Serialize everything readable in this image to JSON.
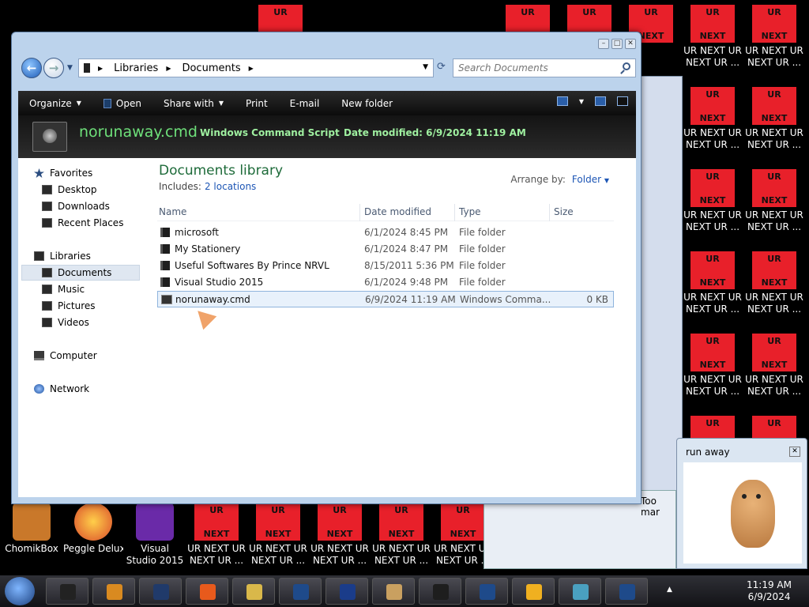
{
  "desktop": {
    "ur_tiles_top": [
      {
        "line1": "UR",
        "line2": ""
      },
      {
        "line1": "UR",
        "line2": ""
      },
      {
        "line1": "UR",
        "line2": ""
      },
      {
        "line1": "UR",
        "line2": "NEXT"
      },
      {
        "line1": "UR",
        "line2": "NEXT"
      },
      {
        "line1": "UR",
        "line2": "NEXT"
      }
    ],
    "ur_tile_label": "UR NEXT UR NEXT UR ...",
    "ur_tile_text1": "UR",
    "ur_tile_text2": "NEXT",
    "bottom_apps": [
      {
        "label": "ChomikBox",
        "color": "#c9782a"
      },
      {
        "label": "Peggle Deluxe",
        "color": "#d94a2a"
      },
      {
        "label": "Visual Studio 2015",
        "color": "#6a2aa8"
      }
    ]
  },
  "explorer": {
    "address": {
      "crumb1": "Libraries",
      "crumb2": "Documents"
    },
    "search_placeholder": "Search Documents",
    "toolbar": {
      "organize": "Organize",
      "open": "Open",
      "share_with": "Share with",
      "print": "Print",
      "email": "E-mail",
      "new_folder": "New folder"
    },
    "details": {
      "name": "norunaway.cmd",
      "type": "Windows Command Script",
      "date": "Date modified: 6/9/2024 11:19 AM"
    },
    "nav": {
      "favorites": "Favorites",
      "desktop": "Desktop",
      "downloads": "Downloads",
      "recent": "Recent Places",
      "libraries": "Libraries",
      "documents": "Documents",
      "music": "Music",
      "pictures": "Pictures",
      "videos": "Videos",
      "computer": "Computer",
      "network": "Network"
    },
    "library": {
      "title": "Documents library",
      "includes_label": "Includes:",
      "locations": "2 locations",
      "arrange_label": "Arrange by:",
      "arrange_value": "Folder"
    },
    "columns": {
      "name": "Name",
      "date": "Date modified",
      "type": "Type",
      "size": "Size"
    },
    "files": [
      {
        "name": "microsoft",
        "date": "6/1/2024 8:45 PM",
        "type": "File folder",
        "size": ""
      },
      {
        "name": "My Stationery",
        "date": "6/1/2024 8:47 PM",
        "type": "File folder",
        "size": ""
      },
      {
        "name": "Useful Softwares By Prince NRVL",
        "date": "8/15/2011 5:36 PM",
        "type": "File folder",
        "size": ""
      },
      {
        "name": "Visual Studio 2015",
        "date": "6/1/2024 9:48 PM",
        "type": "File folder",
        "size": ""
      },
      {
        "name": "norunaway.cmd",
        "date": "6/9/2024 11:19 AM",
        "type": "Windows Comma...",
        "size": "0 KB"
      }
    ]
  },
  "popup": {
    "title": "run away"
  },
  "bg_window_text": "Too mar",
  "taskbar": {
    "time": "11:19 AM",
    "date": "6/9/2024"
  }
}
